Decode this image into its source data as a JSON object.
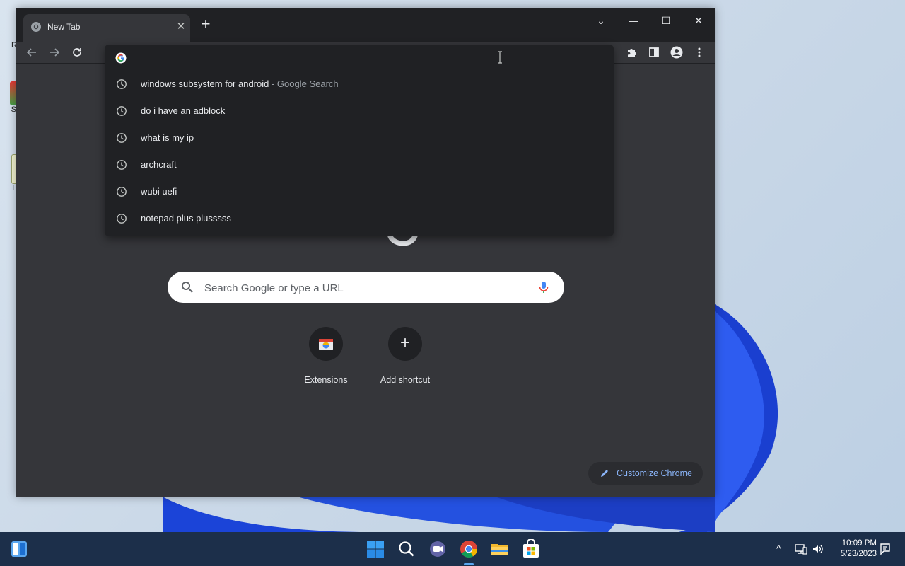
{
  "browser": {
    "tab_title": "New Tab",
    "tab_close": "✕",
    "new_tab": "+",
    "window_controls": {
      "dropdown": "⌄",
      "minimize": "—",
      "maximize": "☐",
      "close": "✕"
    }
  },
  "omnibox": {
    "suggestions": [
      {
        "text": "windows subsystem for android",
        "desc": " - Google Search"
      },
      {
        "text": "do i have an adblock",
        "desc": ""
      },
      {
        "text": "what is my ip",
        "desc": ""
      },
      {
        "text": "archcraft",
        "desc": ""
      },
      {
        "text": "wubi uefi",
        "desc": ""
      },
      {
        "text": "notepad plus plusssss",
        "desc": ""
      }
    ]
  },
  "ntp": {
    "search_placeholder": "Search Google or type a URL",
    "shortcuts": [
      {
        "label": "Extensions"
      },
      {
        "label": "Add shortcut",
        "glyph": "+"
      }
    ],
    "customize_label": "Customize Chrome"
  },
  "desktop": {
    "icons": [
      {
        "label": "Re"
      },
      {
        "label": "SP"
      },
      {
        "label": "l\nfi"
      }
    ]
  },
  "taskbar": {
    "time": "10:09 PM",
    "date": "5/23/2023",
    "chevron": "^"
  },
  "colors": {
    "accent_blue": "#8ab4f8",
    "frame": "#202124",
    "page_bg": "#35363a",
    "wallpaper_blue": "#1c49d8"
  }
}
